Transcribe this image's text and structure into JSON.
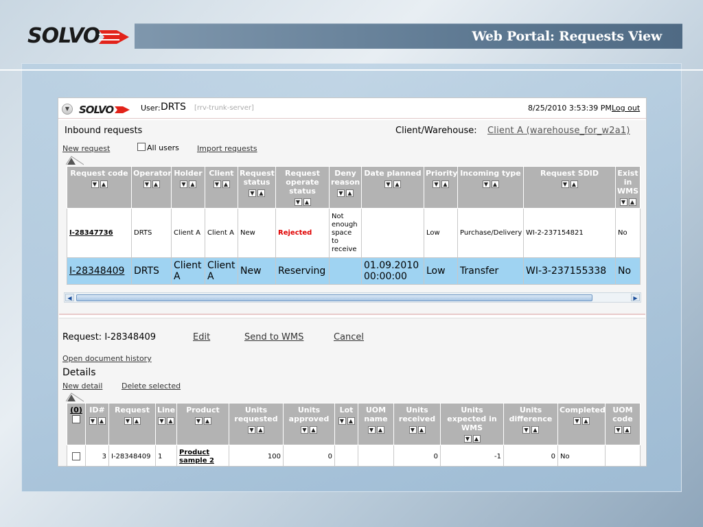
{
  "slide": {
    "title": "Web Portal: Requests View",
    "accent_red": "#e2231a",
    "title_bar_color": "#5f7a93"
  },
  "topbar": {
    "user_label": "User:",
    "user_name": "DRTS",
    "server": "[rrv-trunk-server]",
    "datetime": "8/25/2010 3:53:39 PM",
    "logout": "Log out"
  },
  "inbound": {
    "title": "Inbound requests",
    "client_wh_label": "Client/Warehouse:",
    "client_wh_value": "Client A (warehouse_for_w2a1)",
    "new_request": "New request",
    "all_users": "All users",
    "import_requests": "Import requests",
    "columns": [
      "Request code",
      "Operator",
      "Holder",
      "Client",
      "Request status",
      "Request operate status",
      "Deny reason",
      "Date planned",
      "Priority",
      "Incoming type",
      "Request SDID",
      "Exist in WMS"
    ],
    "rows": [
      [
        "I-28347736",
        "DRTS",
        "Client A",
        "Client A",
        "New",
        "Rejected",
        "Not enough space to receive",
        "",
        "Low",
        "Purchase/Delivery",
        "WI-2-237154821",
        "No"
      ],
      [
        "I-28348409",
        "DRTS",
        "Client A",
        "Client A",
        "New",
        "Reserving",
        "",
        "01.09.2010 00:00:00",
        "Low",
        "Transfer",
        "WI-3-237155338",
        "No"
      ]
    ],
    "selected_color": "#9fd3f2",
    "rejected_color": "#e00000"
  },
  "request": {
    "label": "Request: I-28348409",
    "edit": "Edit",
    "send_to_wms": "Send to WMS",
    "cancel": "Cancel",
    "history": "Open document history",
    "details_title": "Details",
    "new_detail": "New detail",
    "delete_selected": "Delete selected"
  },
  "details": {
    "select_all": "(0)",
    "columns": [
      "ID#",
      "Request",
      "Line",
      "Product",
      "Units requested",
      "Units approved",
      "Lot",
      "UOM name",
      "Units received",
      "Units expected in WMS",
      "Units difference",
      "Completed",
      "UOM code"
    ],
    "rows": [
      [
        "3",
        "I-28348409",
        "1",
        "Product sample 2",
        "100",
        "0",
        "",
        "",
        "0",
        "-1",
        "0",
        "No",
        ""
      ]
    ]
  }
}
